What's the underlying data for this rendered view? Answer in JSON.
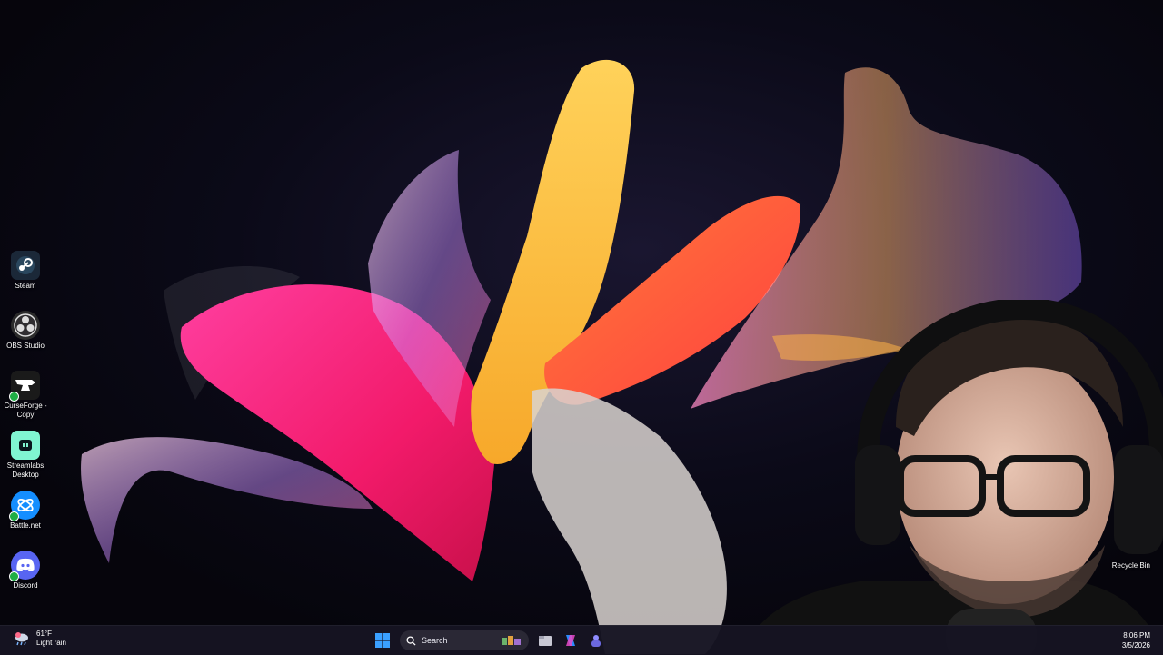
{
  "desktop": {
    "icons": [
      {
        "id": "steam",
        "label": "Steam",
        "icon": "steam-icon",
        "color": "#1b2838",
        "shortcut": false
      },
      {
        "id": "obs",
        "label": "OBS Studio",
        "icon": "obs-icon",
        "color": "#2b2b2b",
        "shortcut": false
      },
      {
        "id": "curseforge",
        "label": "CurseForge -\nCopy",
        "icon": "curseforge-icon",
        "color": "#1a1a1a",
        "shortcut": true
      },
      {
        "id": "streamlabs",
        "label": "Streamlabs\nDesktop",
        "icon": "streamlabs-icon",
        "color": "#80f5d2",
        "shortcut": false
      },
      {
        "id": "battlenet",
        "label": "Battle.net",
        "icon": "battlenet-icon",
        "color": "#148eff",
        "shortcut": true
      },
      {
        "id": "discord",
        "label": "Discord",
        "icon": "discord-icon",
        "color": "#5865f2",
        "shortcut": true
      }
    ],
    "recycle_bin_label": "Recycle Bin"
  },
  "taskbar": {
    "weather": {
      "temp": "61°F",
      "condition": "Light rain",
      "icon": "rain-cloud-icon"
    },
    "start_icon": "windows-logo-icon",
    "search": {
      "label": "Search",
      "icon": "search-icon"
    },
    "apps": [
      "file-explorer-icon",
      "task-view-icon",
      "copilot-icon",
      "teams-icon"
    ],
    "clock": {
      "time": "8:06 PM",
      "date": "3/5/2026"
    }
  },
  "colors": {
    "accent": "#0078d4",
    "taskbar": "#161422"
  }
}
